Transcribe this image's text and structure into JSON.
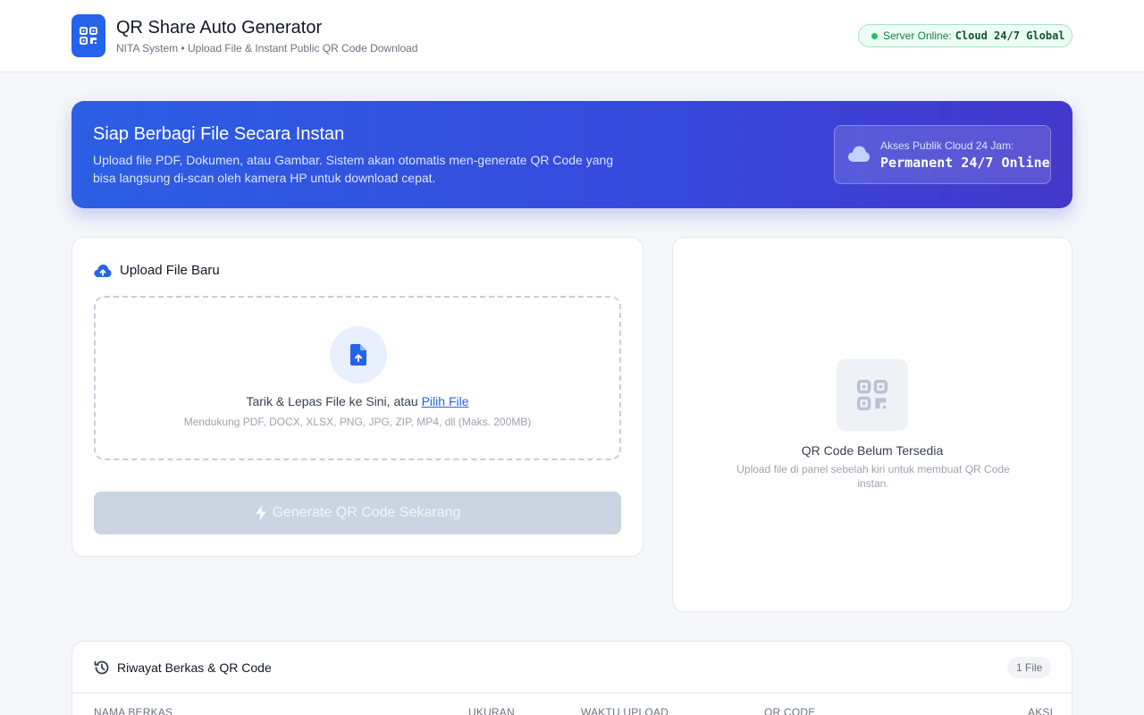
{
  "header": {
    "title": "QR Share Auto Generator",
    "subtitle": "NITA System • Upload File & Instant Public QR Code Download",
    "server_label": "Server Online:",
    "server_value": "Cloud 24/7 Global"
  },
  "hero": {
    "title": "Siap Berbagi File Secara Instan",
    "description": "Upload file PDF, Dokumen, atau Gambar. Sistem akan otomatis men-generate QR Code yang bisa langsung di-scan oleh kamera HP untuk download cepat.",
    "card_label": "Akses Publik Cloud 24 Jam:",
    "card_value": "Permanent 24/7 Online"
  },
  "upload": {
    "title": "Upload File Baru",
    "drop_text": "Tarik & Lepas File ke Sini, atau",
    "pick_link": "Pilih File",
    "hint": "Mendukung PDF, DOCX, XLSX, PNG, JPG, ZIP, MP4, dll (Maks. 200MB)",
    "generate_label": "Generate QR Code Sekarang"
  },
  "qr_preview": {
    "title": "QR Code Belum Tersedia",
    "description": "Upload file di panel sebelah kiri untuk membuat QR Code instan."
  },
  "history": {
    "title": "Riwayat Berkas & QR Code",
    "count": "1 File",
    "columns": [
      "NAMA BERKAS",
      "UKURAN",
      "WAKTU UPLOAD",
      "QR CODE",
      "AKSI"
    ]
  },
  "colors": {
    "primary": "#2563eb",
    "success": "#22c55e",
    "disabled": "#cbd5e1"
  }
}
